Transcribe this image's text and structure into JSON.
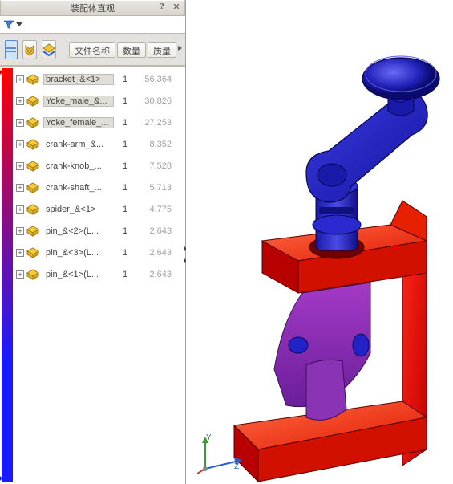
{
  "panel": {
    "title": "装配体直观",
    "filter_label": "",
    "col_filename": "文件名称",
    "col_qty": "数量",
    "col_mass": "质量"
  },
  "tree": [
    {
      "name": "bracket_&<1>",
      "qty": "1",
      "mass": "56.364",
      "selected": true
    },
    {
      "name": "Yoke_male_&...",
      "qty": "1",
      "mass": "30.826",
      "selected": true
    },
    {
      "name": "Yoke_female_...",
      "qty": "1",
      "mass": "27.253",
      "selected": true
    },
    {
      "name": "crank-arm_&...",
      "qty": "1",
      "mass": "8.352",
      "selected": false
    },
    {
      "name": "crank-knob_...",
      "qty": "1",
      "mass": "7.528",
      "selected": false
    },
    {
      "name": "crank-shaft_...",
      "qty": "1",
      "mass": "5.713",
      "selected": false
    },
    {
      "name": "spider_&<1>",
      "qty": "1",
      "mass": "4.775",
      "selected": false
    },
    {
      "name": "pin_&<2>(L...",
      "qty": "1",
      "mass": "2.643",
      "selected": false
    },
    {
      "name": "pin_&<3>(L...",
      "qty": "1",
      "mass": "2.643",
      "selected": false
    },
    {
      "name": "pin_&<1>(L...",
      "qty": "1",
      "mass": "2.643",
      "selected": false
    }
  ],
  "triad": {
    "y": "Y",
    "z": "Z"
  }
}
